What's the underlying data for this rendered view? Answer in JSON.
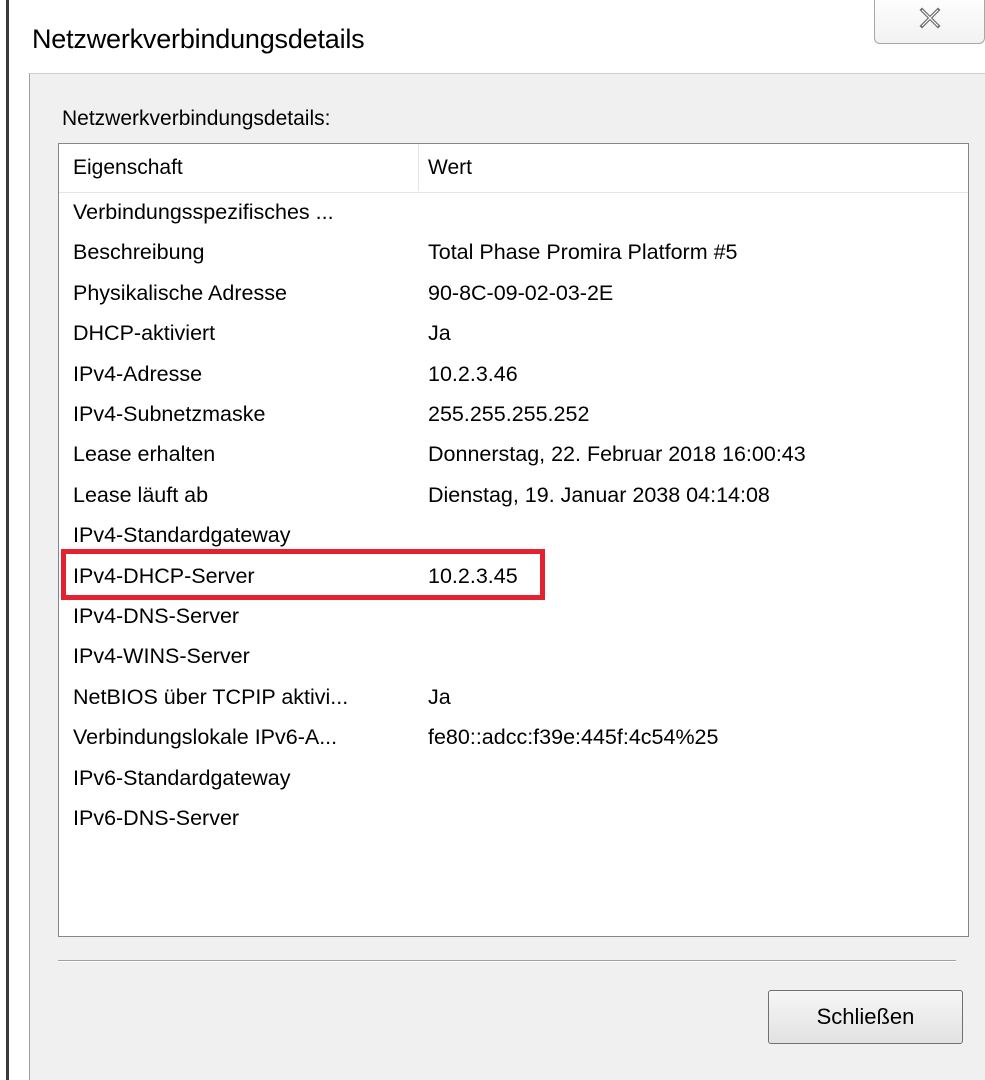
{
  "window": {
    "title": "Netzwerkverbindungsdetails"
  },
  "group_label": "Netzwerkverbindungsdetails:",
  "list": {
    "columns": [
      "Eigenschaft",
      "Wert"
    ],
    "rows": [
      {
        "property": "Verbindungsspezifisches ...",
        "value": ""
      },
      {
        "property": "Beschreibung",
        "value": "Total Phase Promira Platform #5"
      },
      {
        "property": "Physikalische Adresse",
        "value": "90-8C-09-02-03-2E"
      },
      {
        "property": "DHCP-aktiviert",
        "value": "Ja"
      },
      {
        "property": "IPv4-Adresse",
        "value": "10.2.3.46"
      },
      {
        "property": "IPv4-Subnetzmaske",
        "value": "255.255.255.252"
      },
      {
        "property": "Lease erhalten",
        "value": "Donnerstag, 22. Februar 2018 16:00:43"
      },
      {
        "property": "Lease läuft ab",
        "value": "Dienstag, 19. Januar 2038 04:14:08"
      },
      {
        "property": "IPv4-Standardgateway",
        "value": ""
      },
      {
        "property": "IPv4-DHCP-Server",
        "value": "10.2.3.45"
      },
      {
        "property": "IPv4-DNS-Server",
        "value": ""
      },
      {
        "property": "IPv4-WINS-Server",
        "value": ""
      },
      {
        "property": "NetBIOS über TCPIP aktivi...",
        "value": "Ja"
      },
      {
        "property": "Verbindungslokale IPv6-A...",
        "value": "fe80::adcc:f39e:445f:4c54%25"
      },
      {
        "property": "IPv6-Standardgateway",
        "value": ""
      },
      {
        "property": "IPv6-DNS-Server",
        "value": ""
      }
    ]
  },
  "buttons": {
    "close_label": "Schließen"
  },
  "icons": {
    "window_close": "close-icon"
  },
  "colors": {
    "highlight": "#e4222f",
    "dialog_bg": "#f0f0f0"
  }
}
